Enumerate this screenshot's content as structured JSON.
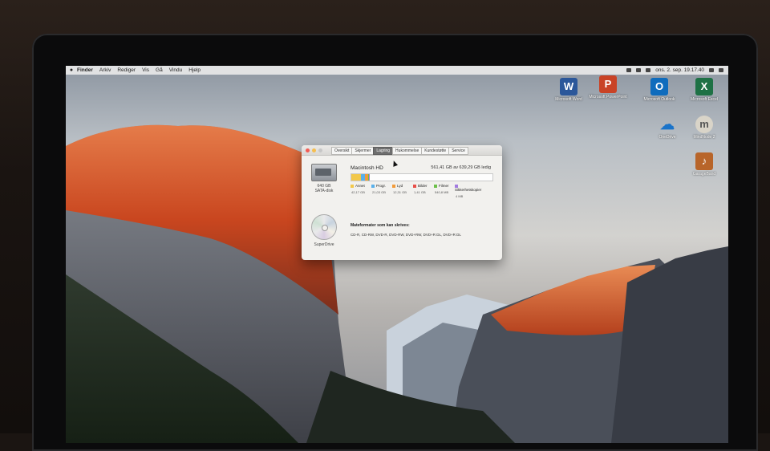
{
  "menubar": {
    "apple": "",
    "items": [
      "Finder",
      "Arkiv",
      "Rediger",
      "Vis",
      "Gå",
      "Vindu",
      "Hjelp"
    ],
    "clock": "ons. 2. sep. 19.17.40"
  },
  "desktop_icons": [
    {
      "label": "Microsoft Word",
      "glyph": "W",
      "color": "#2b579a",
      "icon": "word-icon"
    },
    {
      "label": "Microsoft PowerPoint",
      "glyph": "P",
      "color": "#c94326",
      "icon": "powerpoint-icon"
    },
    {
      "label": "Microsoft Outlook",
      "glyph": "O",
      "color": "#0f6cbd",
      "icon": "outlook-icon"
    },
    {
      "label": "Microsoft Excel",
      "glyph": "X",
      "color": "#1e7145",
      "icon": "excel-icon"
    },
    {
      "label": "OneDrive",
      "glyph": "☁",
      "color": "#1a73c9",
      "icon": "onedrive-icon"
    },
    {
      "label": "MindNode 2",
      "glyph": "m",
      "color": "#d9d4c8",
      "icon": "mindnode-icon"
    },
    {
      "label": "GarageBand",
      "glyph": "♪",
      "color": "#b8652a",
      "icon": "guitar-icon"
    }
  ],
  "about_window": {
    "tabs": [
      "Oversikt",
      "Skjermer",
      "Lagring",
      "Hukommelse",
      "Kundestøtte",
      "Service"
    ],
    "active_tab": "Lagring",
    "disk_label_1": "640 GB",
    "disk_label_2": "SATA-disk",
    "optical_label": "SuperDrive",
    "volume_name": "Macintosh HD",
    "volume_free": "561,41 GB av 639,29 GB ledig",
    "usage": [
      {
        "name": "Annet",
        "size": "42,17 GB",
        "color": "#f2c84b",
        "fraction": 0.066
      },
      {
        "name": "Progr.",
        "size": "21,03 GB",
        "color": "#5ab0ea",
        "fraction": 0.033
      },
      {
        "name": "Lyd",
        "size": "12,31 GB",
        "color": "#f29b3a",
        "fraction": 0.019
      },
      {
        "name": "Bilder",
        "size": "1,41 GB",
        "color": "#e8504a",
        "fraction": 0.003
      },
      {
        "name": "Filmer",
        "size": "540,8 MB",
        "color": "#6cc04a",
        "fraction": 0.002
      },
      {
        "name": "Sikkerhetskopier",
        "size": "4 MB",
        "color": "#a27be0",
        "fraction": 0.001
      }
    ],
    "formats_heading": "Mateformater som kan skrives:",
    "formats_text": "CD-R, CD-RW, DVD-R, DVD-RW, DVD+RW, DVD+R DL, DVD+R DL"
  }
}
